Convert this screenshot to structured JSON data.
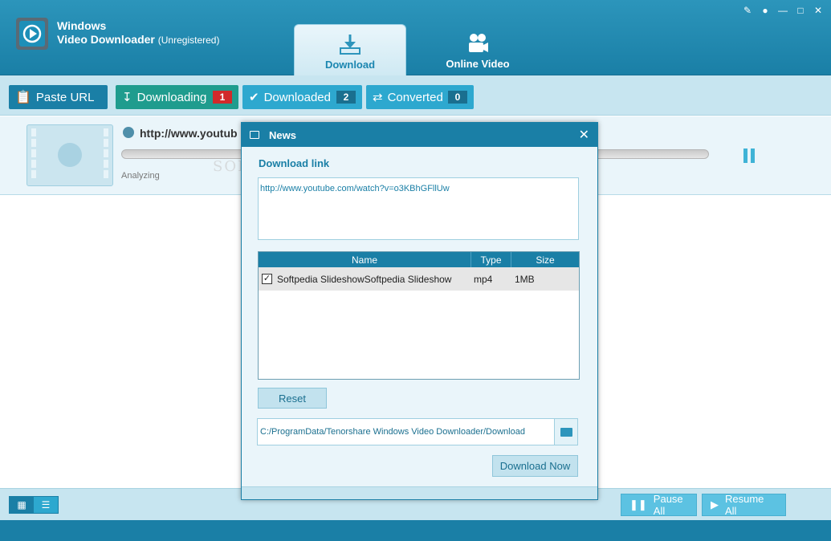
{
  "app": {
    "title_line1": "Windows",
    "title_line2": "Video Downloader",
    "registration": "(Unregistered)"
  },
  "window_controls": [
    "feedback-icon",
    "chat-icon",
    "minimize-icon",
    "maximize-icon",
    "close-icon"
  ],
  "tabs": [
    {
      "label": "Download",
      "active": true,
      "icon": "download-icon"
    },
    {
      "label": "Online Video",
      "active": false,
      "icon": "video-camera-icon"
    }
  ],
  "toolbar": {
    "paste_url": "Paste URL",
    "downloading": {
      "label": "Downloading",
      "count": "1"
    },
    "downloaded": {
      "label": "Downloaded",
      "count": "2"
    },
    "converted": {
      "label": "Converted",
      "count": "0"
    }
  },
  "item": {
    "url": "http://www.youtub",
    "status": "Analyzing"
  },
  "watermark": "SOFTPEDIA",
  "dialog": {
    "title": "News",
    "link_label": "Download link",
    "link_value": "http://www.youtube.com/watch?v=o3KBhGFllUw",
    "columns": {
      "name": "Name",
      "type": "Type",
      "size": "Size"
    },
    "rows": [
      {
        "name": "Softpedia SlideshowSoftpedia Slideshow",
        "type": "mp4",
        "size": "1MB",
        "checked": true
      }
    ],
    "reset": "Reset",
    "path": "C:/ProgramData/Tenorshare Windows Video Downloader/Download",
    "download_now": "Download Now"
  },
  "bottom": {
    "pause_all": "Pause All",
    "resume_all": "Resume All"
  },
  "colors": {
    "primary": "#1a7fa6",
    "accent": "#2da8cf",
    "badge_red": "#d12a2a",
    "downloading": "#1f9c8e"
  }
}
